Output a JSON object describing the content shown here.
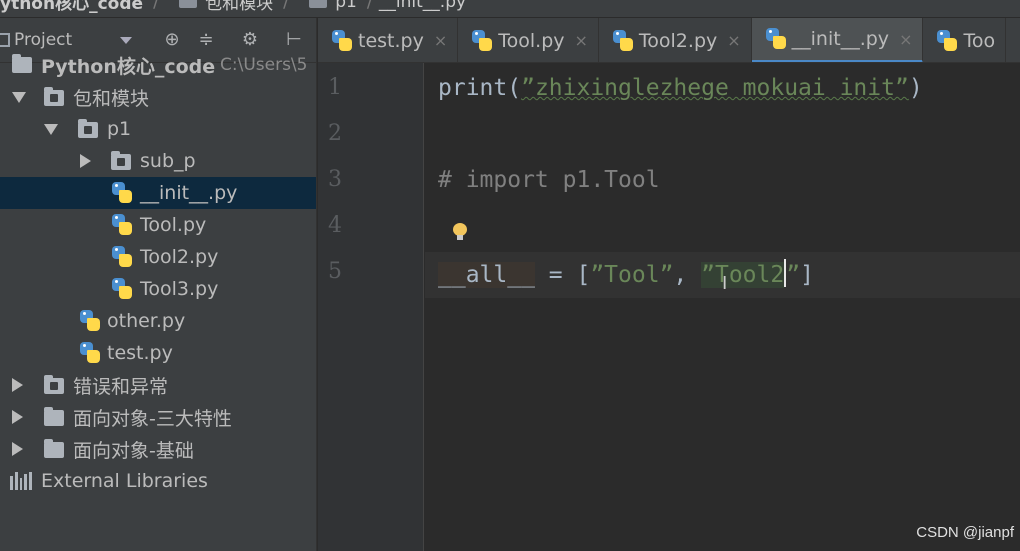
{
  "breadcrumb": {
    "items": [
      "ython核心_code",
      "包和模块",
      "p1",
      "__init__.py"
    ]
  },
  "sidebar": {
    "header_label": "Project",
    "tree": [
      {
        "label": "Python核心_code",
        "path": "C:\\Users\\5",
        "level": 0,
        "state": "expanded",
        "kind": "folder"
      },
      {
        "label": "包和模块",
        "level": 1,
        "state": "expanded",
        "kind": "folder"
      },
      {
        "label": "p1",
        "level": 2,
        "state": "expanded",
        "kind": "folder"
      },
      {
        "label": "sub_p",
        "level": 3,
        "state": "collapsed",
        "kind": "folder"
      },
      {
        "label": "__init__.py",
        "level": 3,
        "kind": "py",
        "selected": true
      },
      {
        "label": "Tool.py",
        "level": 3,
        "kind": "py"
      },
      {
        "label": "Tool2.py",
        "level": 3,
        "kind": "py"
      },
      {
        "label": "Tool3.py",
        "level": 3,
        "kind": "py"
      },
      {
        "label": "other.py",
        "level": 2,
        "kind": "py"
      },
      {
        "label": "test.py",
        "level": 2,
        "kind": "py"
      },
      {
        "label": "错误和异常",
        "level": 1,
        "state": "collapsed",
        "kind": "folder"
      },
      {
        "label": "面向对象-三大特性",
        "level": 1,
        "state": "collapsed",
        "kind": "folder"
      },
      {
        "label": "面向对象-基础",
        "level": 1,
        "state": "collapsed",
        "kind": "folder"
      },
      {
        "label": "External Libraries",
        "level": 0,
        "kind": "lib"
      }
    ]
  },
  "tabs": [
    {
      "label": "test.py",
      "close": "×"
    },
    {
      "label": "Tool.py",
      "close": "×"
    },
    {
      "label": "Tool2.py",
      "close": "×"
    },
    {
      "label": "__init__.py",
      "close": "×",
      "active": true
    },
    {
      "label": "Too",
      "close": ""
    }
  ],
  "editor": {
    "line_numbers": [
      "1",
      "2",
      "3",
      "4",
      "5"
    ],
    "line1": {
      "fn": "print(",
      "str": "”zhixinglezhege mokuai init”",
      "end": ")"
    },
    "line3": "# import p1.Tool",
    "line5": {
      "dunder": "__all__",
      "mid": " = [",
      "s1": "”Tool”",
      "comma": ", ",
      "s2": "”Tool2",
      "s2end": "”",
      "end": "]"
    }
  },
  "watermark": "CSDN @jianpf",
  "colors": {
    "background": "#2b2b2b",
    "sidebar": "#3c3f41",
    "selection": "#0d293e",
    "string": "#6a8759",
    "comment": "#808080",
    "tab_accent": "#4a88c7"
  }
}
